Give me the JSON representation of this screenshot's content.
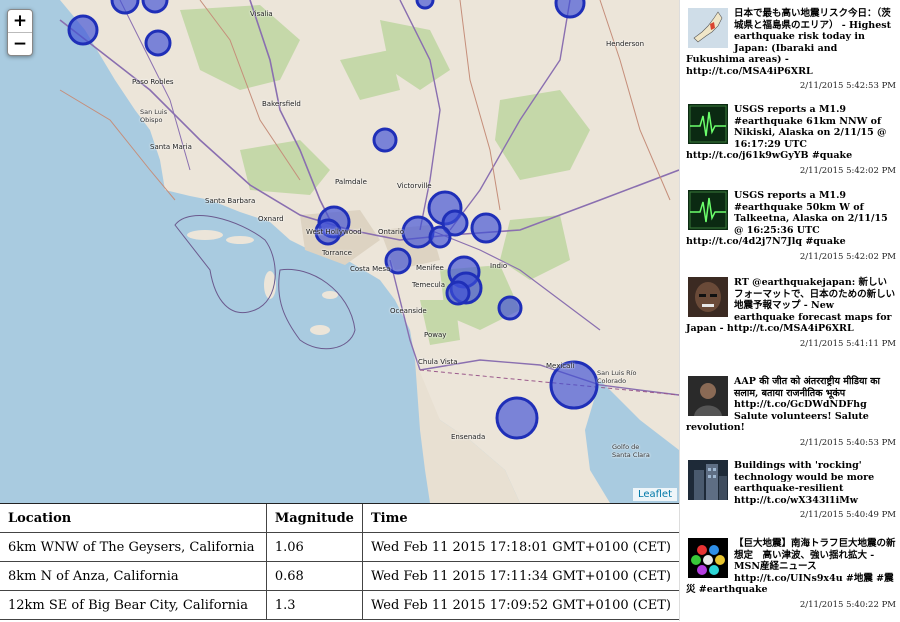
{
  "map": {
    "zoom_in": "+",
    "zoom_out": "−",
    "attribution": "Leaflet",
    "places": [
      "Visalia",
      "Henderson",
      "Paso Robles",
      "Bakersfield",
      "San Luis Obispo",
      "Santa Maria",
      "Palmdale",
      "Victorville",
      "Santa Barbara",
      "Oxnard",
      "West Hollywood",
      "Torrance",
      "Ontario",
      "Costa Mesa",
      "Menifee",
      "Temecula",
      "Indio",
      "Oceanside",
      "Poway",
      "Chula Vista",
      "Mexicali",
      "San Luis Río Colorado",
      "Ensenada",
      "Golfo de Santa Clara"
    ]
  },
  "table": {
    "headers": [
      "Location",
      "Magnitude",
      "Time"
    ],
    "rows": [
      [
        "6km WNW of The Geysers, California",
        "1.06",
        "Wed Feb 11 2015 17:18:01 GMT+0100 (CET)"
      ],
      [
        "8km N of Anza, California",
        "0.68",
        "Wed Feb 11 2015 17:11:34 GMT+0100 (CET)"
      ],
      [
        "12km SE of Big Bear City, California",
        "1.3",
        "Wed Feb 11 2015 17:09:52 GMT+0100 (CET)"
      ]
    ]
  },
  "feed": {
    "tweets": [
      {
        "text": "日本で最も高い地震リスク今日：（茨城県と福島県のエリア） - Highest earthquake risk today in Japan: (Ibaraki and Fukushima areas) - http://t.co/MSA4iP6XRL",
        "date": "2/11/2015 5:42:53 PM",
        "avatar": "japan-map-avatar"
      },
      {
        "text": "USGS reports a M1.9 #earthquake 61km NNW of Nikiski, Alaska on 2/11/15 @ 16:17:29 UTC http://t.co/j61k9wGyYB #quake",
        "date": "2/11/2015 5:42:02 PM",
        "avatar": "seismograph-avatar"
      },
      {
        "text": "USGS reports a M1.9 #earthquake 50km W of Talkeetna, Alaska on 2/11/15 @ 16:25:36 UTC http://t.co/4d2j7N7Jlq #quake",
        "date": "2/11/2015 5:42:02 PM",
        "avatar": "seismograph-avatar"
      },
      {
        "text": "RT @earthquakejapan: 新しいフォーマットで、日本のための新しい地震予報マップ - New earthquake forecast maps for Japan - http://t.co/MSA4iP6XRL",
        "date": "2/11/2015 5:41:11 PM",
        "avatar": "face-avatar"
      },
      {
        "text": "AAP की जीत को अंतरराष्ट्रीय मीडिया का सलाम, बताया राजनीतिक भूकंप http://t.co/GcDWdNDFhg Salute volunteers! Salute revolution!",
        "date": "2/11/2015 5:40:53 PM",
        "avatar": "person-avatar"
      },
      {
        "text": "Buildings with 'rocking' technology would be more earthquake-resilient http://t.co/wX343l1iMw",
        "date": "2/11/2015 5:40:49 PM",
        "avatar": "building-avatar"
      },
      {
        "text": "【巨大地震】南海トラフ巨大地震の新想定　高い津波、強い揺れ拡大 - MSN産経ニュース http://t.co/UINs9x4u #地震 #震災 #earthquake",
        "date": "2/11/2015 5:40:22 PM",
        "avatar": "color-dots-avatar"
      }
    ]
  },
  "colors": {
    "quake_fill": "#3d4fd6",
    "quake_stroke": "#1f2fb8",
    "land": "#ece5d9",
    "park": "#c5d8a9",
    "water": "#a9cbe0"
  }
}
